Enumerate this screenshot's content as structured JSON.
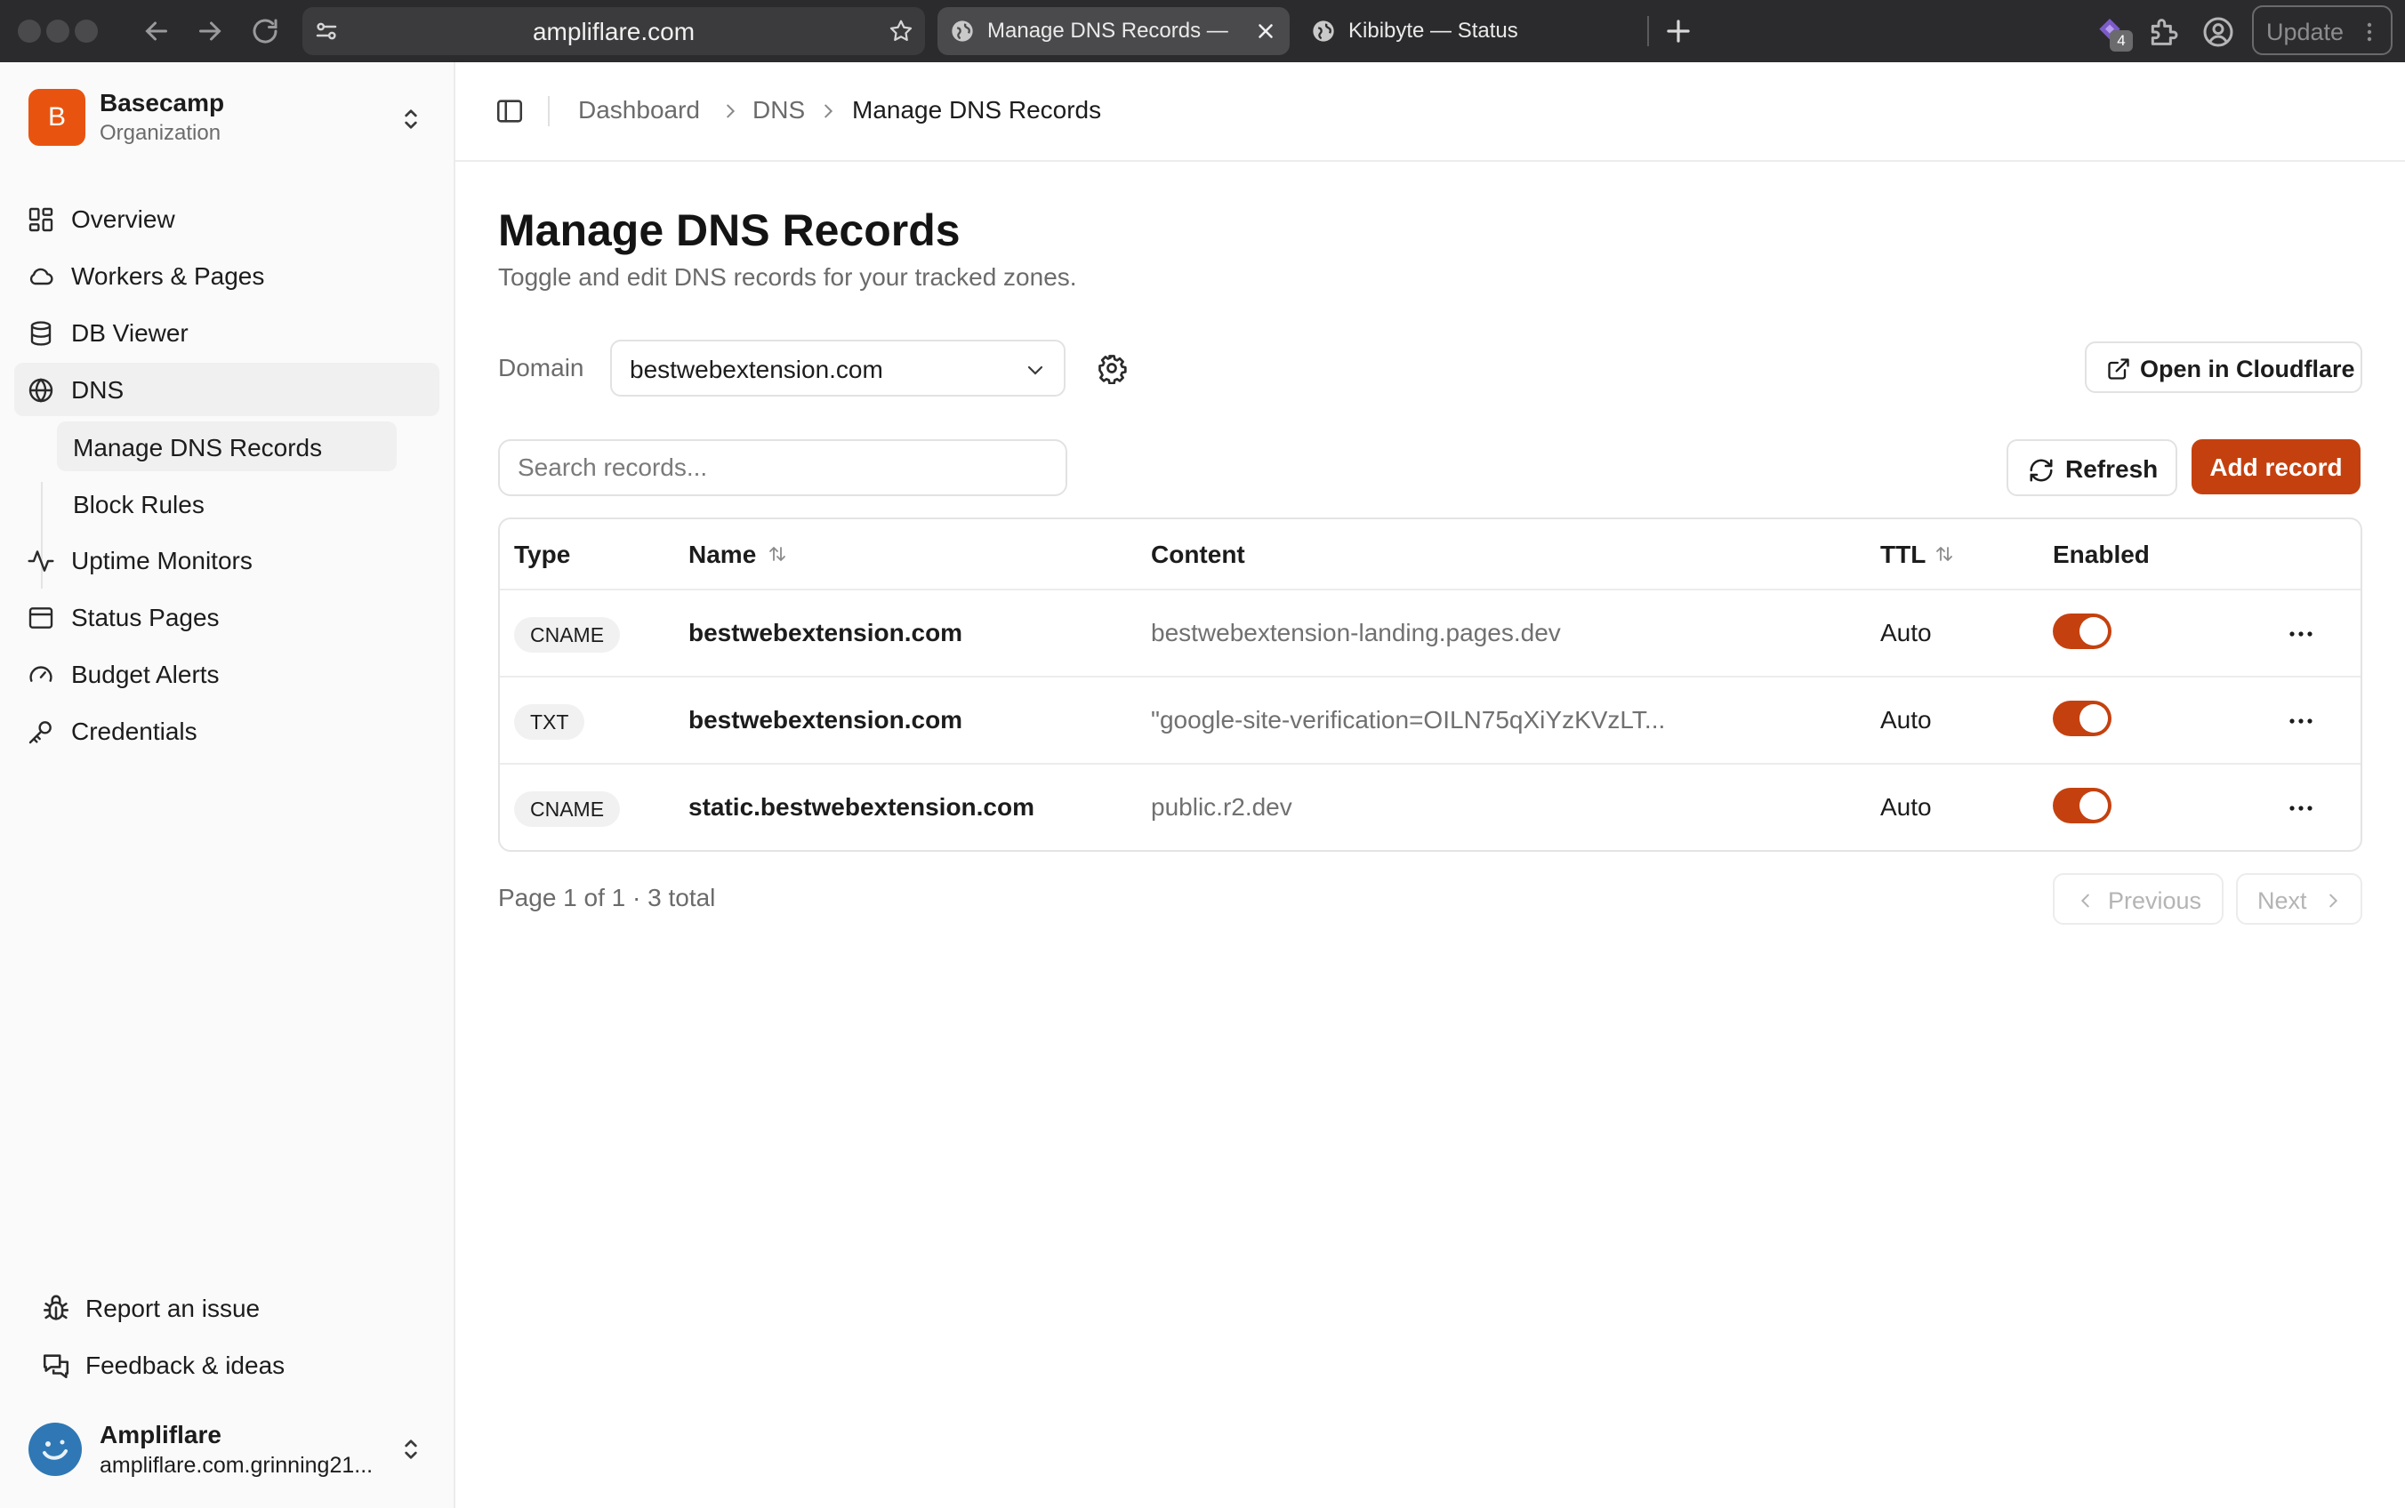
{
  "browser": {
    "url": "ampliflare.com",
    "tabs": [
      {
        "title": "Manage DNS Records — ",
        "active": true
      },
      {
        "title": "Kibibyte — Status",
        "active": false
      }
    ],
    "extension_badge": "4",
    "update_label": "Update"
  },
  "sidebar": {
    "org": {
      "initial": "B",
      "name": "Basecamp",
      "subtitle": "Organization"
    },
    "items": [
      {
        "label": "Overview",
        "icon": "dashboard-grid-icon"
      },
      {
        "label": "Workers & Pages",
        "icon": "cloud-icon"
      },
      {
        "label": "DB Viewer",
        "icon": "database-icon"
      },
      {
        "label": "DNS",
        "icon": "globe-icon"
      },
      {
        "label": "Uptime Monitors",
        "icon": "activity-icon"
      },
      {
        "label": "Status Pages",
        "icon": "layout-icon"
      },
      {
        "label": "Budget Alerts",
        "icon": "gauge-icon"
      },
      {
        "label": "Credentials",
        "icon": "key-icon"
      }
    ],
    "dns_sub_items": [
      {
        "label": "Manage DNS Records"
      },
      {
        "label": "Block Rules"
      }
    ],
    "footer": [
      {
        "label": "Report an issue",
        "icon": "bug-icon"
      },
      {
        "label": "Feedback & ideas",
        "icon": "chat-icon"
      }
    ],
    "user": {
      "name": "Ampliflare",
      "email": "ampliflare.com.grinning21..."
    }
  },
  "breadcrumb": [
    "Dashboard",
    "DNS",
    "Manage DNS Records"
  ],
  "page": {
    "title": "Manage DNS Records",
    "description": "Toggle and edit DNS records for your tracked zones.",
    "domain_label": "Domain",
    "domain_value": "bestwebextension.com",
    "open_cloudflare_label": "Open in Cloudflare",
    "search_placeholder": "Search records...",
    "refresh_label": "Refresh",
    "add_label": "Add record"
  },
  "table": {
    "columns": [
      "Type",
      "Name",
      "Content",
      "TTL",
      "Enabled"
    ],
    "rows": [
      {
        "type": "CNAME",
        "name": "bestwebextension.com",
        "content": "bestwebextension-landing.pages.dev",
        "ttl": "Auto",
        "enabled": true
      },
      {
        "type": "TXT",
        "name": "bestwebextension.com",
        "content": "\"google-site-verification=OILN75qXiYzKVzLT...",
        "ttl": "Auto",
        "enabled": true
      },
      {
        "type": "CNAME",
        "name": "static.bestwebextension.com",
        "content": "public.r2.dev",
        "ttl": "Auto",
        "enabled": true
      }
    ]
  },
  "pagination": {
    "info": "Page 1 of 1 · 3 total",
    "previous": "Previous",
    "next": "Next"
  },
  "colors": {
    "accent": "#c4410f",
    "org_avatar": "#e8540f",
    "chrome": "#2b2b2d"
  }
}
